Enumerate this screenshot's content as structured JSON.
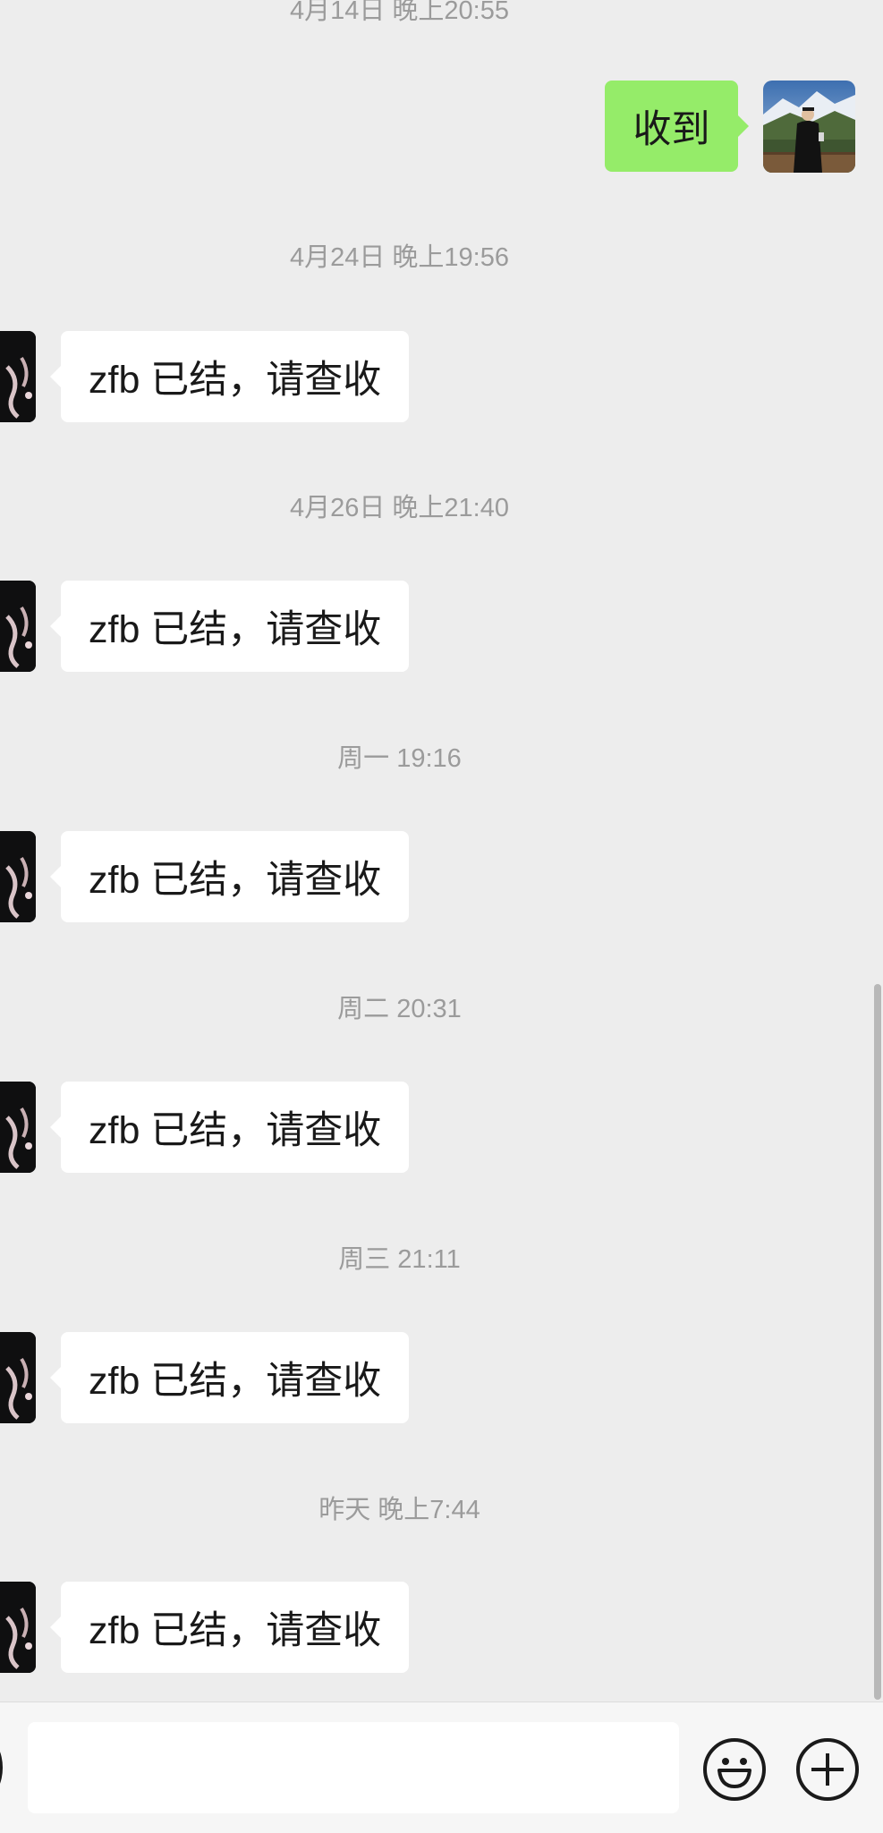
{
  "chat": {
    "timestamps": [
      "4月14日 晚上20:55",
      "4月24日 晚上19:56",
      "4月26日 晚上21:40",
      "周一 19:16",
      "周二 20:31",
      "周三 21:11",
      "昨天 晚上7:44"
    ],
    "sent_message": "收到",
    "received_messages": [
      "zfb 已结，请查收",
      "zfb 已结，请查收",
      "zfb 已结，请查收",
      "zfb 已结，请查收",
      "zfb 已结，请查收",
      "zfb 已结，请查收"
    ]
  },
  "input_bar": {
    "text_value": "",
    "placeholder": ""
  },
  "colors": {
    "background": "#ededed",
    "received_bubble": "#ffffff",
    "sent_bubble": "#95ec69",
    "timestamp_text": "#9b9b9b"
  },
  "icons": {
    "voice": "voice-icon",
    "emoji": "emoji-icon",
    "plus": "plus-icon"
  }
}
